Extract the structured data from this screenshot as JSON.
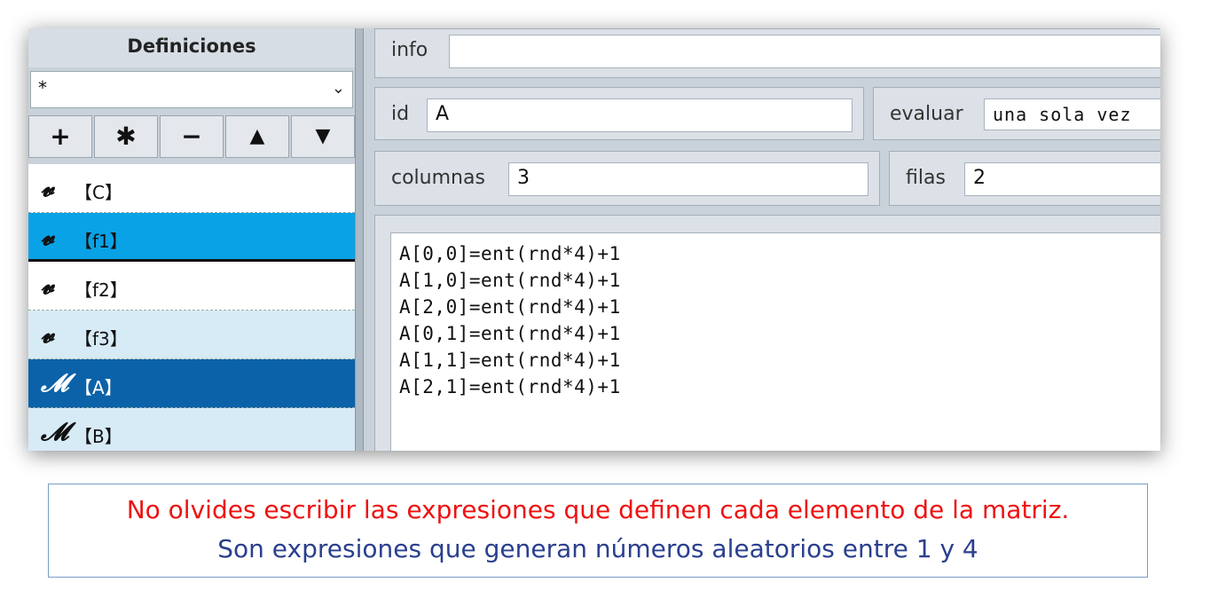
{
  "sidebar": {
    "title": "Definiciones",
    "filter_value": "*",
    "toolbar": {
      "add": "+",
      "duplicate": "✱",
      "remove": "−",
      "up": "▲",
      "down": "▼"
    },
    "items": [
      {
        "icon": "𝓿",
        "label": "【C】",
        "state": "normal"
      },
      {
        "icon": "𝓿",
        "label": "【f1】",
        "state": "hover"
      },
      {
        "icon": "𝓿",
        "label": "【f2】",
        "state": "normal"
      },
      {
        "icon": "𝓿",
        "label": "【f3】",
        "state": "alt"
      },
      {
        "icon": "𝓜",
        "label": "【A】",
        "state": "selected"
      },
      {
        "icon": "𝓜",
        "label": "【B】",
        "state": "alt"
      }
    ]
  },
  "editor": {
    "info_label": "info",
    "info_value": "",
    "id_label": "id",
    "id_value": "A",
    "evaluate_label": "evaluar",
    "evaluate_value": "una sola vez",
    "columns_label": "columnas",
    "columns_value": "3",
    "rows_label": "filas",
    "rows_value": "2",
    "expressions": [
      "A[0,0]=ent(rnd*4)+1",
      "A[1,0]=ent(rnd*4)+1",
      "A[2,0]=ent(rnd*4)+1",
      "A[0,1]=ent(rnd*4)+1",
      "A[1,1]=ent(rnd*4)+1",
      "A[2,1]=ent(rnd*4)+1"
    ]
  },
  "note": {
    "line1": "No olvides escribir las expresiones que definen cada elemento de la matriz.",
    "line2": "Son expresiones que generan números aleatorios entre 1 y 4"
  },
  "colors": {
    "hover": "#0aa2e6",
    "selected": "#0b62a8",
    "alt": "#d7ebf7",
    "note_red": "#ee1111",
    "note_blue": "#2a3f8f"
  }
}
